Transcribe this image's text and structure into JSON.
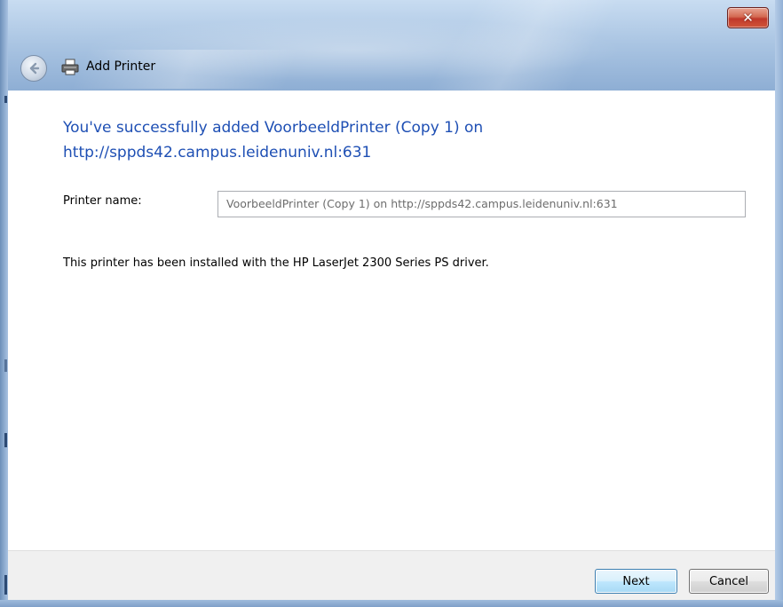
{
  "window": {
    "title": "Add Printer",
    "close_glyph": "✕"
  },
  "icons": {
    "back": "back-arrow-icon",
    "printer": "printer-icon",
    "close": "close-icon"
  },
  "colors": {
    "heading": "#1e4fb4",
    "close_button": "#c0382a",
    "footer_bg": "#f0f0f0"
  },
  "main": {
    "heading_line1": "You've successfully added VoorbeeldPrinter (Copy 1) on",
    "heading_line2": "http://sppds42.campus.leidenuniv.nl:631",
    "printer_name_label": "Printer name:",
    "printer_name_value": "VoorbeeldPrinter (Copy 1) on http://sppds42.campus.leidenuniv.nl:631",
    "driver_message": "This printer has been installed with the HP LaserJet 2300 Series PS driver."
  },
  "footer": {
    "next_label": "Next",
    "cancel_label": "Cancel"
  }
}
